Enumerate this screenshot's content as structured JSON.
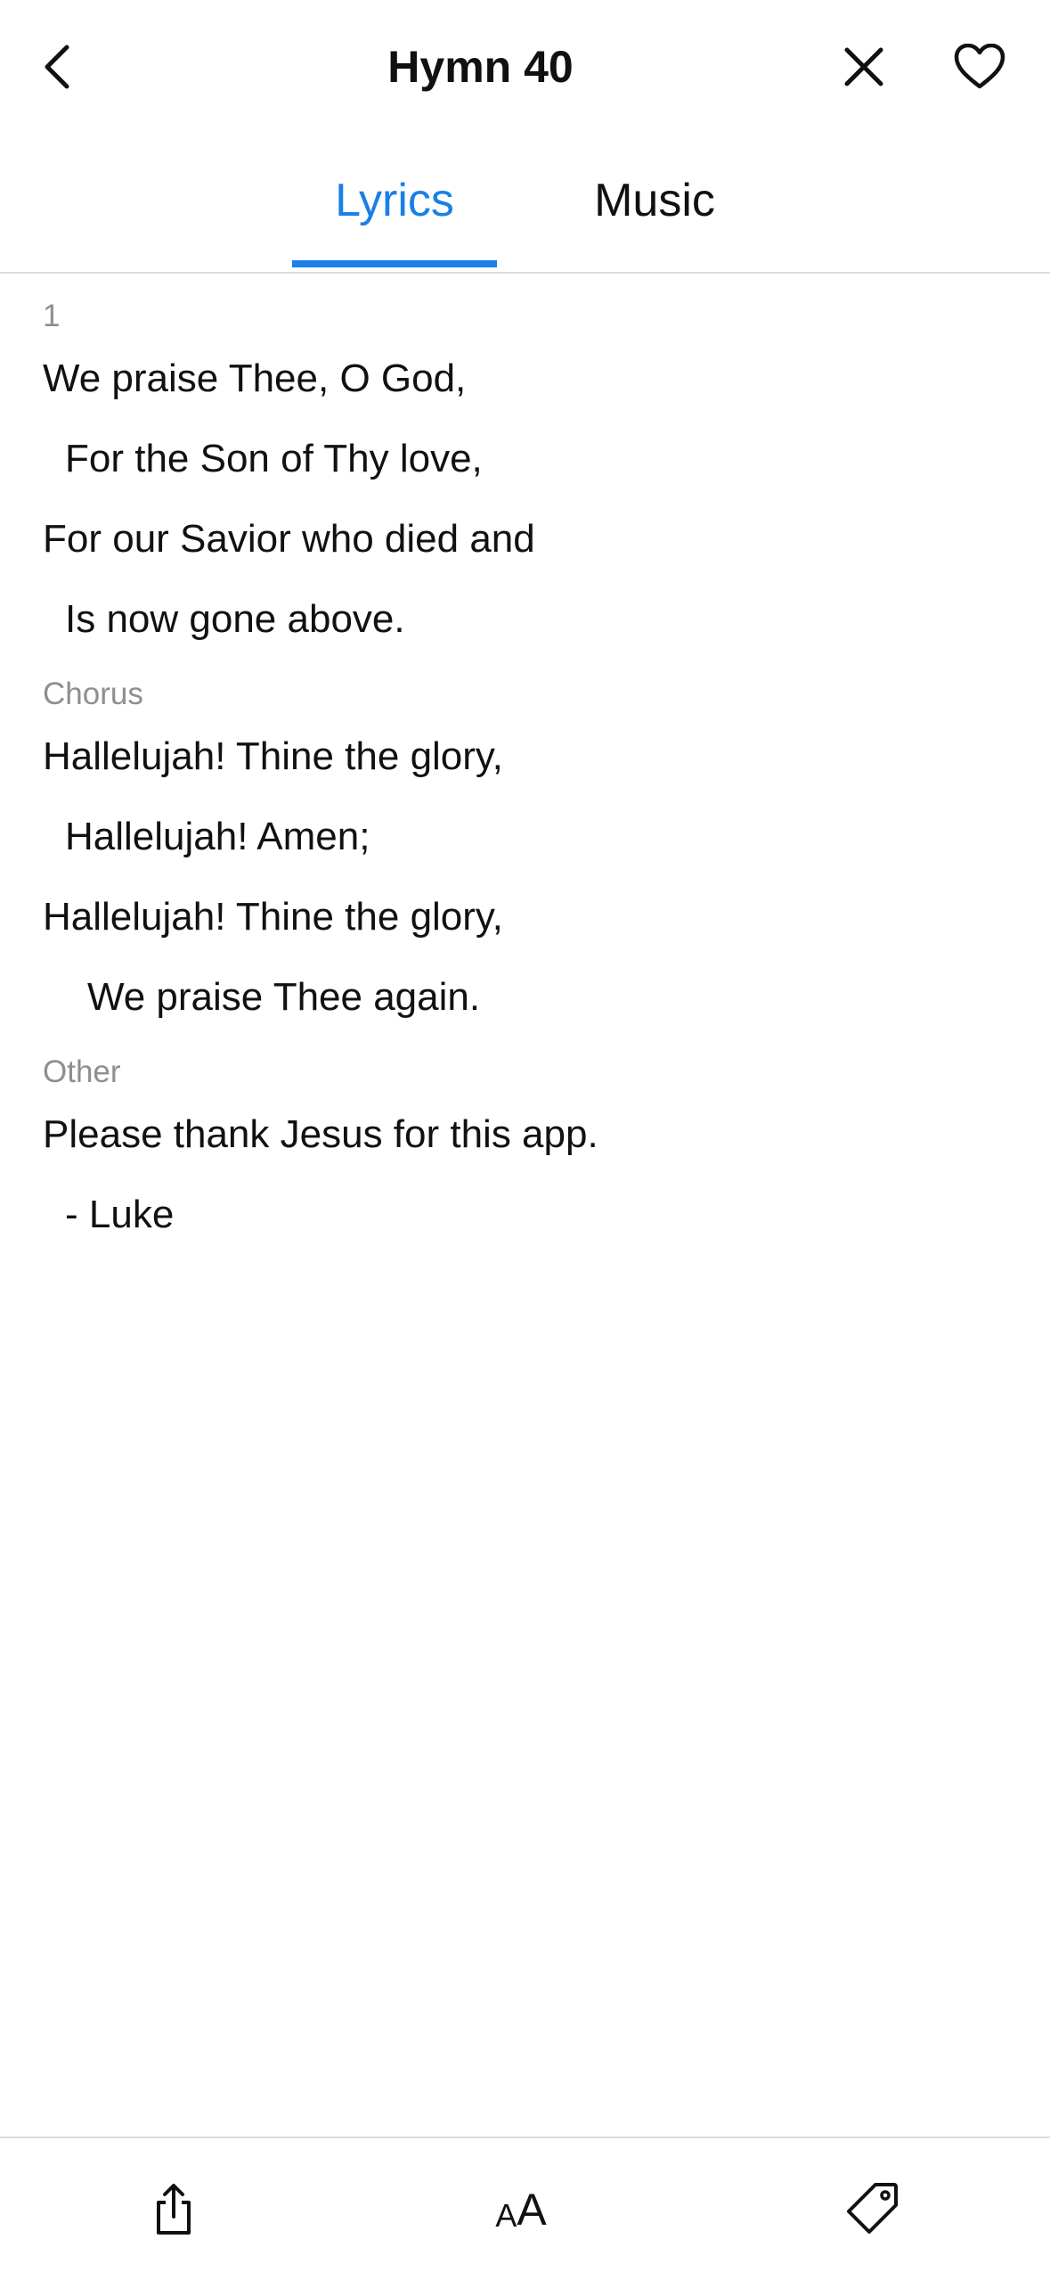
{
  "header": {
    "title": "Hymn 40",
    "icons": [
      "chevron-left-icon",
      "close-icon",
      "heart-icon"
    ]
  },
  "tabs": [
    {
      "label": "Lyrics",
      "active": true
    },
    {
      "label": "Music",
      "active": false
    }
  ],
  "colors": {
    "accent": "#1a7fe8",
    "text": "#111111",
    "muted": "#8e8e93",
    "divider": "#dedede"
  },
  "lyrics": {
    "verse1": {
      "label": "1",
      "lines": [
        "We praise Thee, O God,",
        "For the Son of Thy love,",
        "For our Savior who died and",
        "Is now gone above."
      ]
    },
    "chorus": {
      "label": "Chorus",
      "lines": [
        "Hallelujah! Thine the glory,",
        "Hallelujah! Amen;",
        "Hallelujah! Thine the glory,",
        "We praise Thee again."
      ]
    },
    "other": {
      "label": "Other",
      "lines": [
        "Please thank Jesus for this app.",
        "- Luke"
      ]
    }
  },
  "toolbar": {
    "text_size_small": "A",
    "text_size_large": "A",
    "icons": [
      "share-icon",
      "text-size-icon",
      "tag-icon"
    ]
  }
}
